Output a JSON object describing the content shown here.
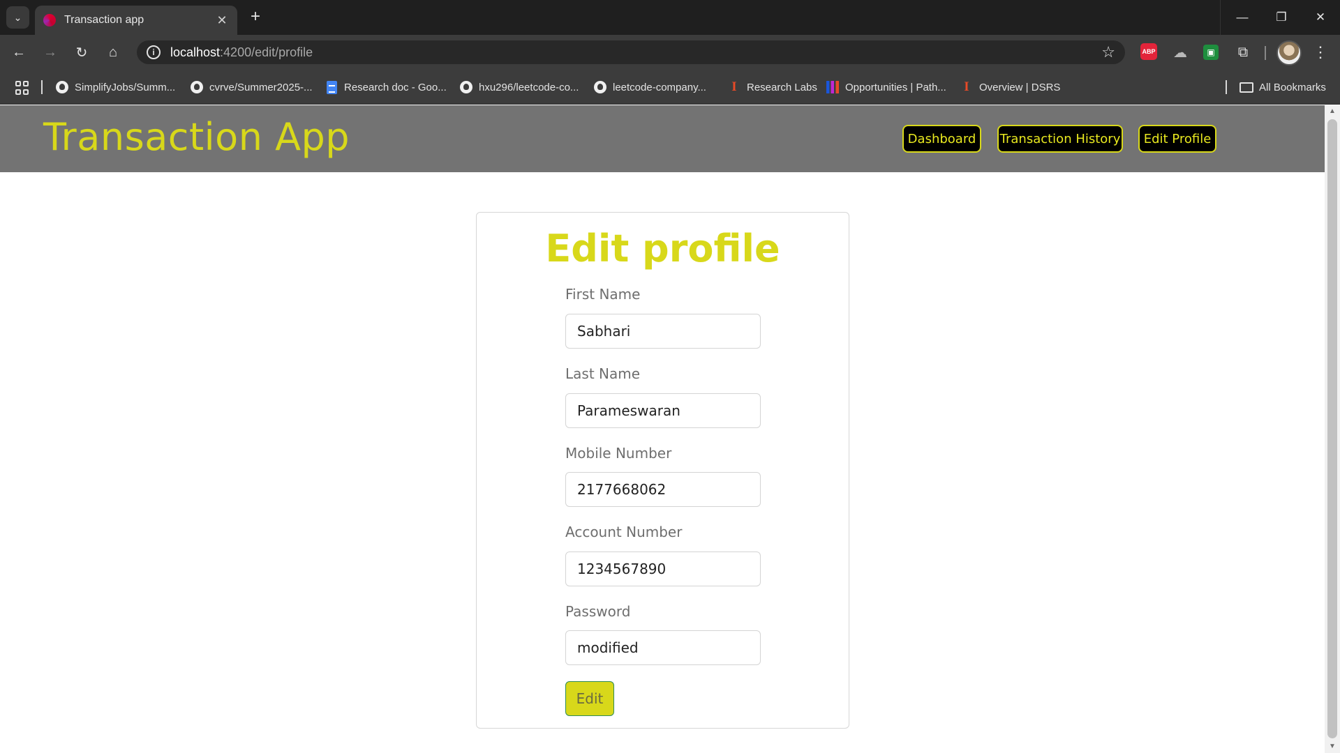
{
  "browser": {
    "tab_title": "Transaction app",
    "url_host": "localhost",
    "url_path": ":4200/edit/profile",
    "abp_label": "ABP",
    "bookmarks": [
      {
        "label": "SimplifyJobs/Summ...",
        "icon": "github-icon"
      },
      {
        "label": "cvrve/Summer2025-...",
        "icon": "github-icon"
      },
      {
        "label": "Research doc - Goo...",
        "icon": "google-docs-icon"
      },
      {
        "label": "hxu296/leetcode-co...",
        "icon": "github-icon"
      },
      {
        "label": "leetcode-company...",
        "icon": "github-icon"
      },
      {
        "label": "Research Labs",
        "icon": "illinois-icon"
      },
      {
        "label": "Opportunities | Path...",
        "icon": "pathway-icon"
      },
      {
        "label": "Overview | DSRS",
        "icon": "illinois-icon"
      }
    ],
    "all_bookmarks_label": "All Bookmarks"
  },
  "app": {
    "brand": "Transaction App",
    "nav": {
      "dashboard": "Dashboard",
      "history": "Transaction History",
      "edit_profile": "Edit Profile"
    }
  },
  "form": {
    "title": "Edit profile",
    "first_name": {
      "label": "First Name",
      "value": "Sabhari"
    },
    "last_name": {
      "label": "Last Name",
      "value": "Parameswaran"
    },
    "mobile": {
      "label": "Mobile Number",
      "value": "2177668062"
    },
    "account": {
      "label": "Account Number",
      "value": "1234567890"
    },
    "password": {
      "label": "Password",
      "value": "modified"
    },
    "submit_label": "Edit"
  },
  "colors": {
    "accent": "#d8d81a",
    "header_bg": "#737373",
    "nav_bg": "#000000"
  }
}
